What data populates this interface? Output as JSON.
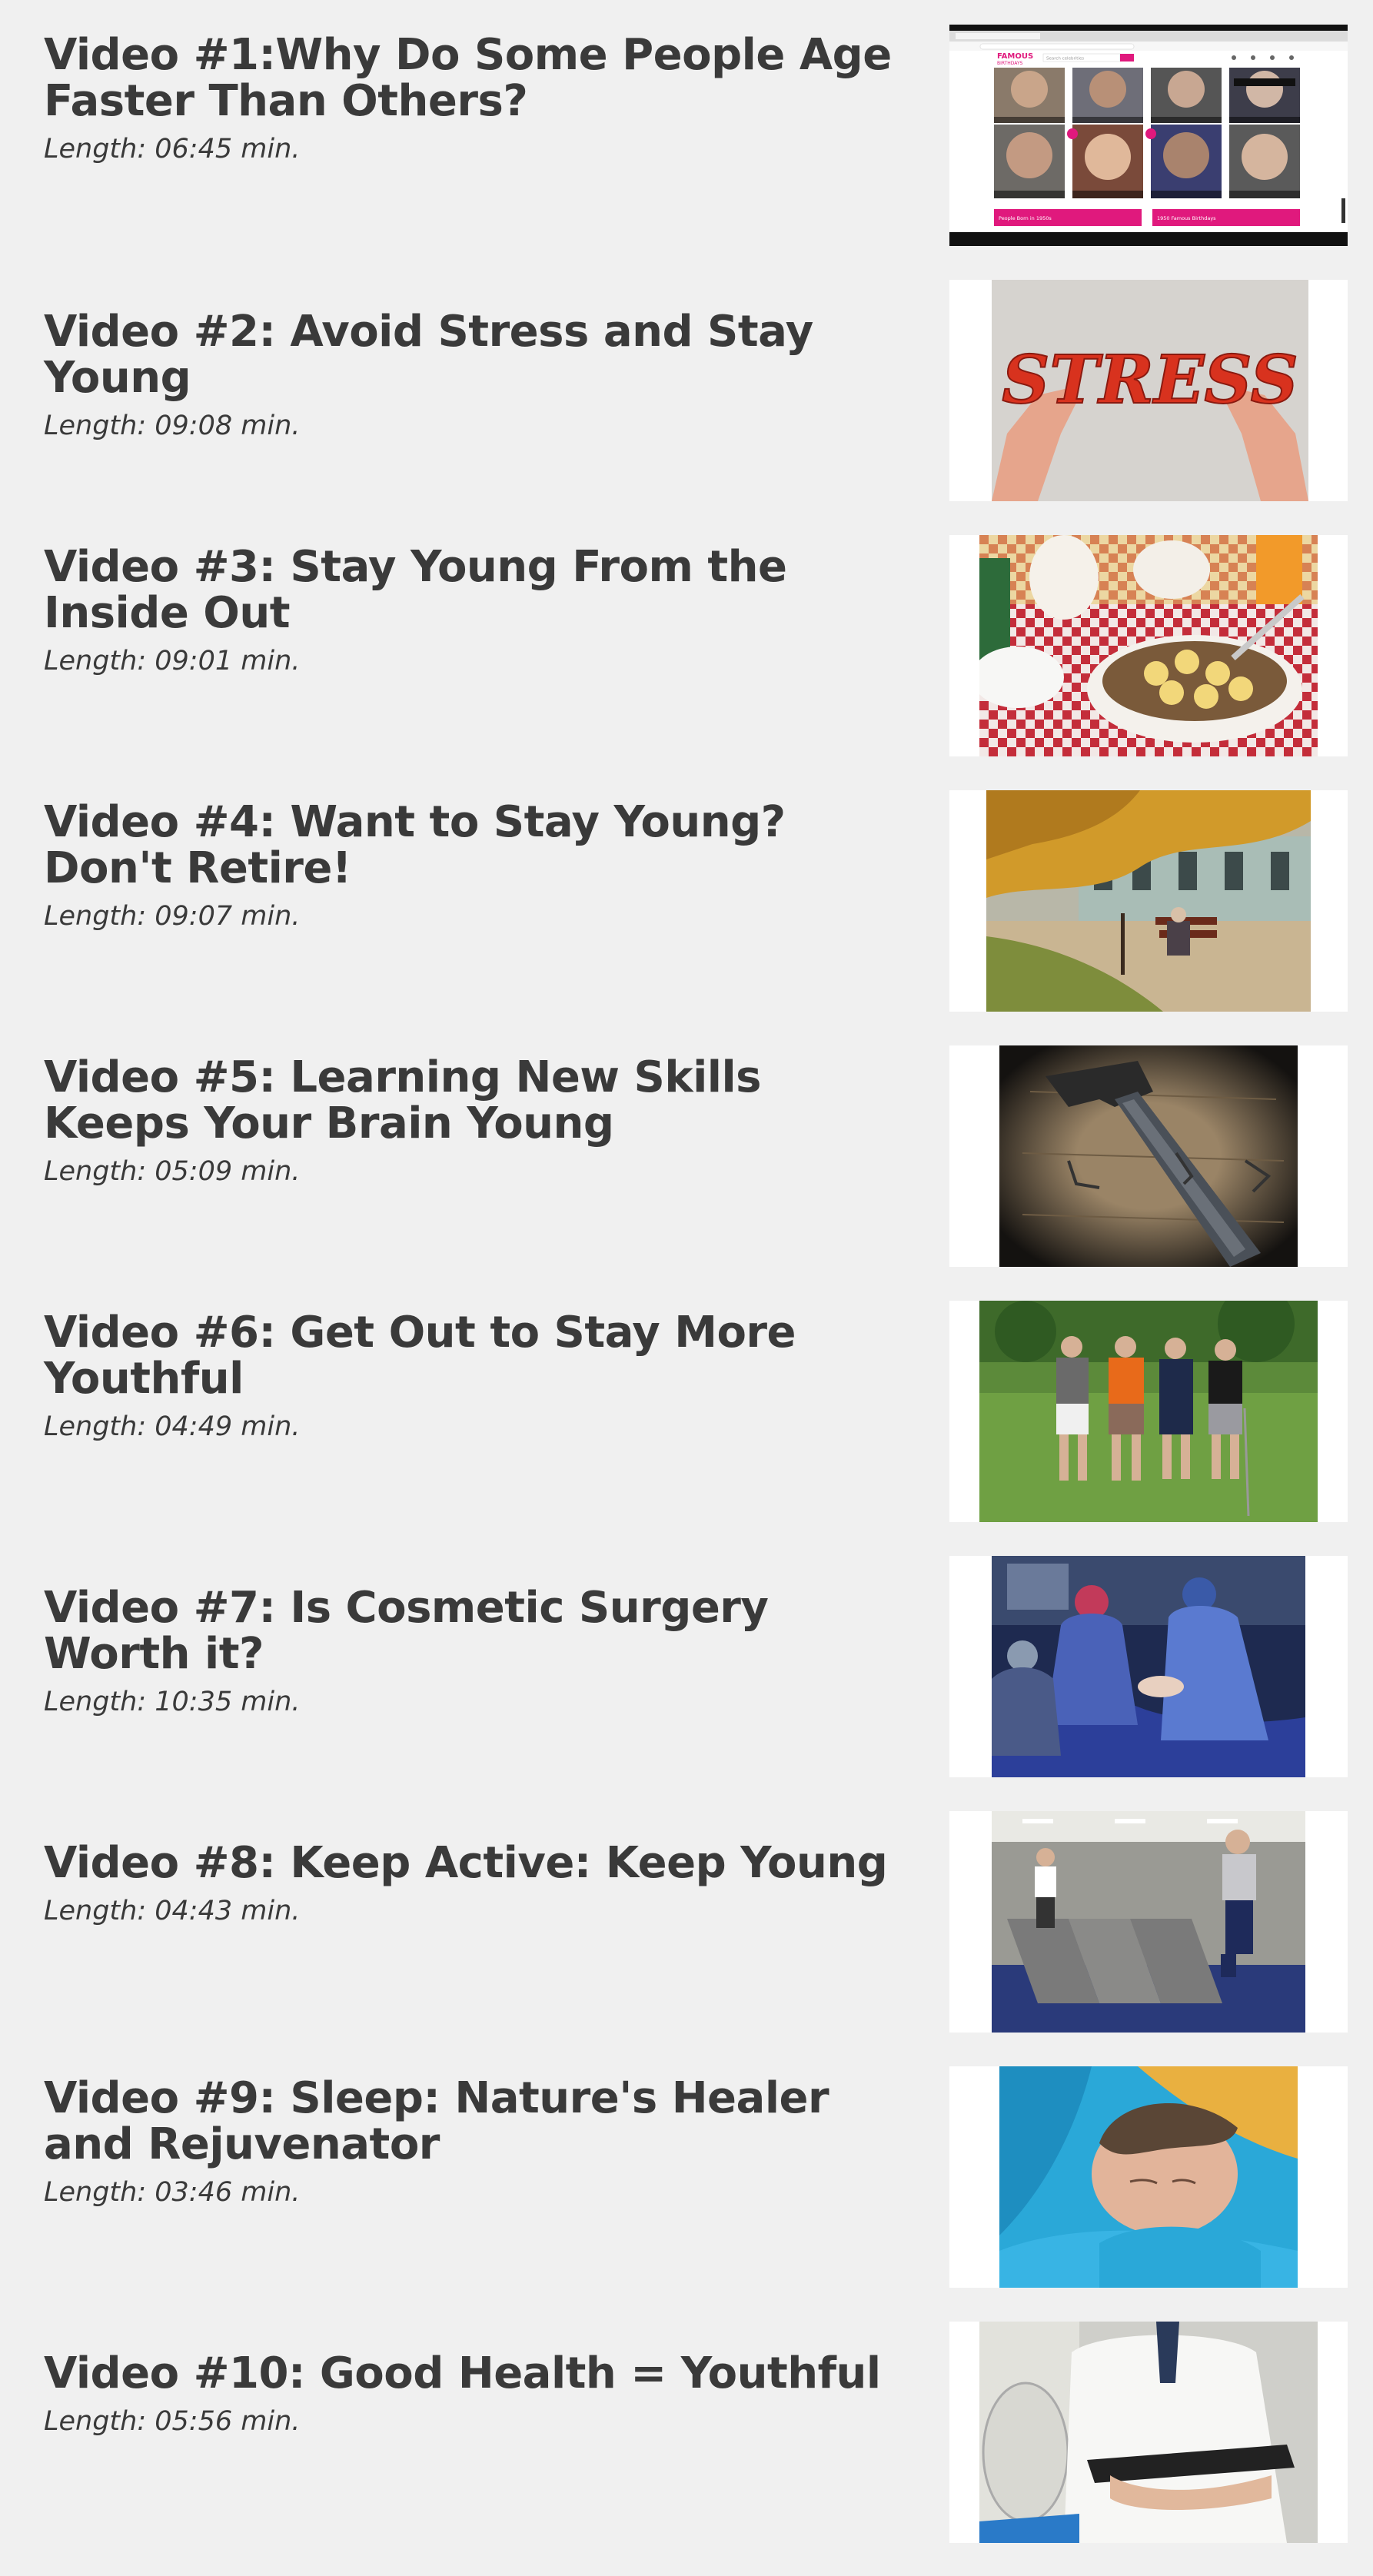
{
  "videos": [
    {
      "title": "Video #1:Why Do Some People Age Faster Than Others?",
      "length": "Length: 06:45 min.",
      "thumbnail": "screenshot of celebrity birthdays website with portrait grid",
      "thumb_text": {
        "logo": "FAMOUS",
        "logo_sub": "BIRTHDAYS",
        "search_placeholder": "Search celebrities",
        "button_1": "People Born in 1950s",
        "button_2": "1950 Famous Birthdays"
      }
    },
    {
      "title": "Video #2: Avoid Stress and Stay Young",
      "length": "Length: 09:08 min.",
      "thumbnail": "hands holding red STRESS letters",
      "thumb_text": {
        "word": "STRESS"
      }
    },
    {
      "title": "Video #3: Stay Young From the Inside Out",
      "length": "Length: 09:01 min.",
      "thumbnail": "bowl of cereal with banana slices on checkered tablecloth"
    },
    {
      "title": "Video #4: Want to Stay Young? Don't Retire!",
      "length": "Length: 09:07 min.",
      "thumbnail": "elderly man sitting on park bench under autumn tree"
    },
    {
      "title": "Video #5: Learning New Skills Keeps Your Brain Young",
      "length": "Length: 05:09 min.",
      "thumbnail": "hammer and bent nails on wood"
    },
    {
      "title": "Video #6: Get Out to Stay More Youthful",
      "length": "Length: 04:49 min.",
      "thumbnail": "four golfers standing on green"
    },
    {
      "title": "Video #7: Is Cosmetic Surgery Worth it?",
      "length": "Length: 10:35 min.",
      "thumbnail": "surgeons operating in blue scrubs"
    },
    {
      "title": "Video #8: Keep Active: Keep Young",
      "length": "Length: 04:43 min.",
      "thumbnail": "people exercising on elliptical machines in gym"
    },
    {
      "title": "Video #9: Sleep: Nature's Healer and Rejuvenator",
      "length": "Length: 03:46 min.",
      "thumbnail": "man sleeping on blue pillow"
    },
    {
      "title": "Video #10: Good Health = Youthful",
      "length": "Length: 05:56 min.",
      "thumbnail": "doctor in white coat holding clipboard"
    }
  ],
  "colors": {
    "background": "#f0f0f0",
    "text": "#3a3a3a",
    "thumb_frame": "#ffffff",
    "accent_pink": "#e0197d"
  }
}
